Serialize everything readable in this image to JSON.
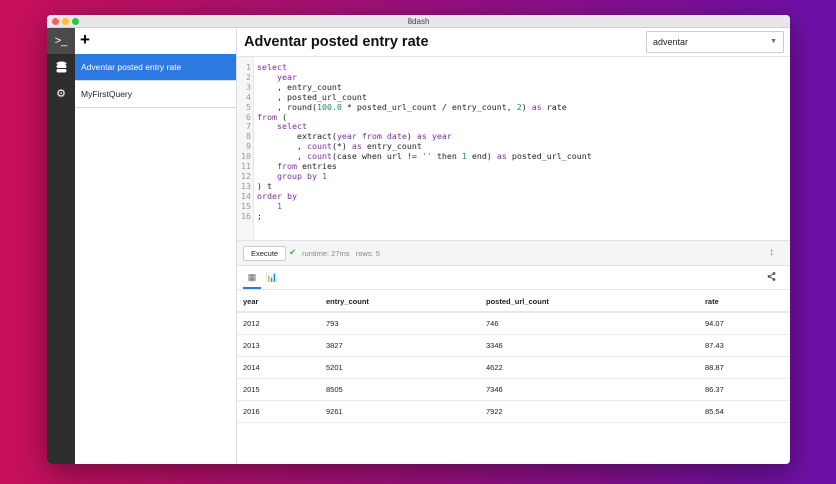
{
  "window": {
    "title": "8dash"
  },
  "sidebar": {
    "icons": [
      "terminal-icon",
      "database-icon",
      "gear-icon"
    ]
  },
  "queries": {
    "add_label": "+",
    "items": [
      {
        "label": "Adventar posted entry rate",
        "selected": true
      },
      {
        "label": "MyFirstQuery",
        "selected": false
      }
    ]
  },
  "header": {
    "title": "Adventar posted entry rate",
    "datasource": "adventar"
  },
  "editor": {
    "lines": [
      [
        [
          "select",
          "kw"
        ]
      ],
      [
        [
          "    "
        ],
        [
          "year",
          "kw"
        ]
      ],
      [
        [
          "    , entry_count"
        ]
      ],
      [
        [
          "    , posted_url_count"
        ]
      ],
      [
        [
          "    , round("
        ],
        [
          "100.0",
          "num"
        ],
        [
          " * posted_url_count / entry_count, "
        ],
        [
          "2",
          "num"
        ],
        [
          ") "
        ],
        [
          "as",
          "kw"
        ],
        [
          " rate"
        ]
      ],
      [
        [
          "from",
          "kw"
        ],
        [
          " ("
        ]
      ],
      [
        [
          "    "
        ],
        [
          "select",
          "kw"
        ]
      ],
      [
        [
          "        extract("
        ],
        [
          "year from date",
          "kw"
        ],
        [
          ") "
        ],
        [
          "as year",
          "kw"
        ]
      ],
      [
        [
          "        , "
        ],
        [
          "count",
          "kw"
        ],
        [
          "(*) "
        ],
        [
          "as",
          "kw"
        ],
        [
          " entry_count"
        ]
      ],
      [
        [
          "        , "
        ],
        [
          "count",
          "kw"
        ],
        [
          "(case when url != "
        ],
        [
          "''",
          "str"
        ],
        [
          " then "
        ],
        [
          "1",
          "num"
        ],
        [
          " end) "
        ],
        [
          "as",
          "kw"
        ],
        [
          " posted_url_count"
        ]
      ],
      [
        [
          "    "
        ],
        [
          "from",
          "kw"
        ],
        [
          " entries"
        ]
      ],
      [
        [
          "    "
        ],
        [
          "group by",
          "kw"
        ],
        [
          " "
        ],
        [
          "1",
          "num"
        ]
      ],
      [
        [
          ") t"
        ]
      ],
      [
        [
          "order by",
          "kw"
        ]
      ],
      [
        [
          "    "
        ],
        [
          "1",
          "num"
        ]
      ],
      [
        [
          ";"
        ]
      ]
    ]
  },
  "execution": {
    "button": "Execute",
    "status": "runtime: 27ms   rows: 5"
  },
  "results": {
    "columns": [
      "year",
      "entry_count",
      "posted_url_count",
      "rate"
    ],
    "rows": [
      [
        "2012",
        "793",
        "746",
        "94.07"
      ],
      [
        "2013",
        "3827",
        "3346",
        "87.43"
      ],
      [
        "2014",
        "5201",
        "4622",
        "88.87"
      ],
      [
        "2015",
        "8505",
        "7346",
        "86.37"
      ],
      [
        "2016",
        "9261",
        "7922",
        "85.54"
      ]
    ]
  }
}
